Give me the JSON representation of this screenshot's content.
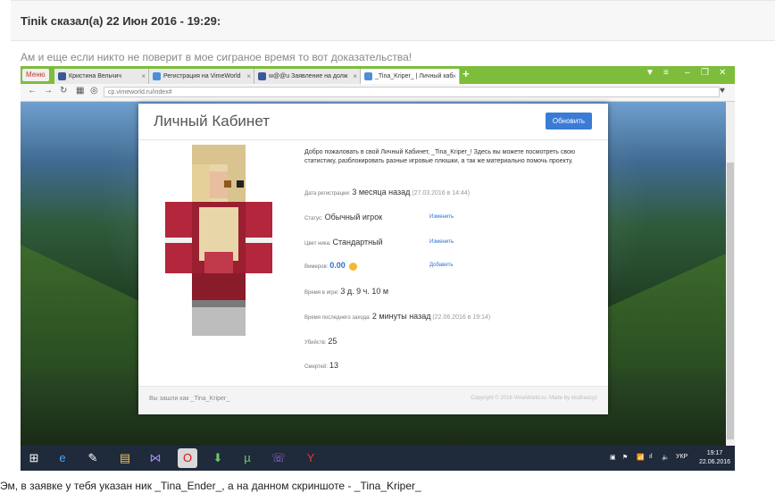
{
  "post": {
    "header": "Tinik сказал(а) 22 Июн 2016 - 19:29:",
    "intro": "Ам и еще если никто не поверит в мое сиграное время то вот доказательства!",
    "footer": "Эм, в заявке у тебя указан ник _Tina_Ender_, а на данном скриншоте - _Tina_Kriper_"
  },
  "browser": {
    "menu_label": "Меню",
    "tabs": [
      {
        "label": "Кристина Вельчич",
        "color": "#3b5998",
        "active": false
      },
      {
        "label": "Регистрация на VimeWorld",
        "color": "#4a90d9",
        "active": false
      },
      {
        "label": "w@@u Заявление на долж",
        "color": "#3b5998",
        "active": false
      },
      {
        "label": "_Tina_Kriper_ | Личный каб",
        "color": "#4a90d9",
        "active": true
      }
    ],
    "new_tab": "+",
    "url": "cp.vimeworld.ru/index#"
  },
  "cabinet": {
    "title": "Личный Кабинет",
    "refresh_label": "Обновить",
    "welcome": "Добро пожаловать в свой Личный Кабинет, _Tina_Kriper_! Здесь вы можете посмотреть свою статистику, разблокировать разные игровые плюшки, а так же материально помочь проекту.",
    "reg_label": "Дата регистрации:",
    "reg_value": "3 месяца назад",
    "reg_date": "(27.03.2016 в 14:44)",
    "status_label": "Статус:",
    "status_value": "Обычный игрок",
    "status_action": "Изменить",
    "color_label": "Цвет ника:",
    "color_value": "Стандартный",
    "color_action": "Изменить",
    "vimers_label": "Вимеров:",
    "vimers_value": "0.00",
    "vimers_action": "Добавить",
    "playtime_label": "Время в игре:",
    "playtime_value": "3 д. 9 ч. 10 м",
    "lastlogin_label": "Время последнего захода:",
    "lastlogin_value": "2 минуты назад",
    "lastlogin_date": "(22.06.2016 в 19:14)",
    "kills_label": "Убийств:",
    "kills_value": "25",
    "deaths_label": "Смертей:",
    "deaths_value": "13",
    "footer_left": "Вы зашли как _Tina_Kriper_",
    "footer_right": "Copyright © 2016 VimeWorld.ru. Made by xtrafrancyz"
  },
  "taskbar": {
    "lang": "УКР",
    "time": "19:17",
    "date": "22.06.2016"
  }
}
